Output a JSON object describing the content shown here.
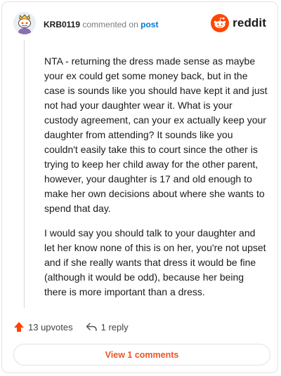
{
  "comment": {
    "username": "KRB0119",
    "action_text": "commented on",
    "target_text": "post",
    "paragraphs": [
      "NTA - returning the dress made sense as maybe your ex could get some money back, but in the case is sounds like you should have kept it and just not had your daughter wear it. What is your custody agreement, can your ex actually keep your daughter from attending? It sounds like you couldn't easily take this to court since the other is trying to keep her child away for the other parent, however, your daughter is 17 and old enough to make her own decisions about where she wants to spend that day.",
      "I would say you should talk to your daughter and let her know none of this is on her, you're not upset and if she really wants that dress it would be fine (although it would be odd), because her being there is more important than a dress."
    ]
  },
  "brand": {
    "name": "reddit",
    "icon": "reddit-logo-icon",
    "color": "#ff4500"
  },
  "actions": {
    "upvotes_label": "13 upvotes",
    "reply_label": "1 reply",
    "upvote_icon": "upvote-arrow-icon",
    "reply_icon": "reply-arrow-icon"
  },
  "footer": {
    "view_comments_label": "View 1 comments"
  },
  "colors": {
    "accent": "#ff4500",
    "link": "#0079d3",
    "button_text": "#e8562a"
  }
}
